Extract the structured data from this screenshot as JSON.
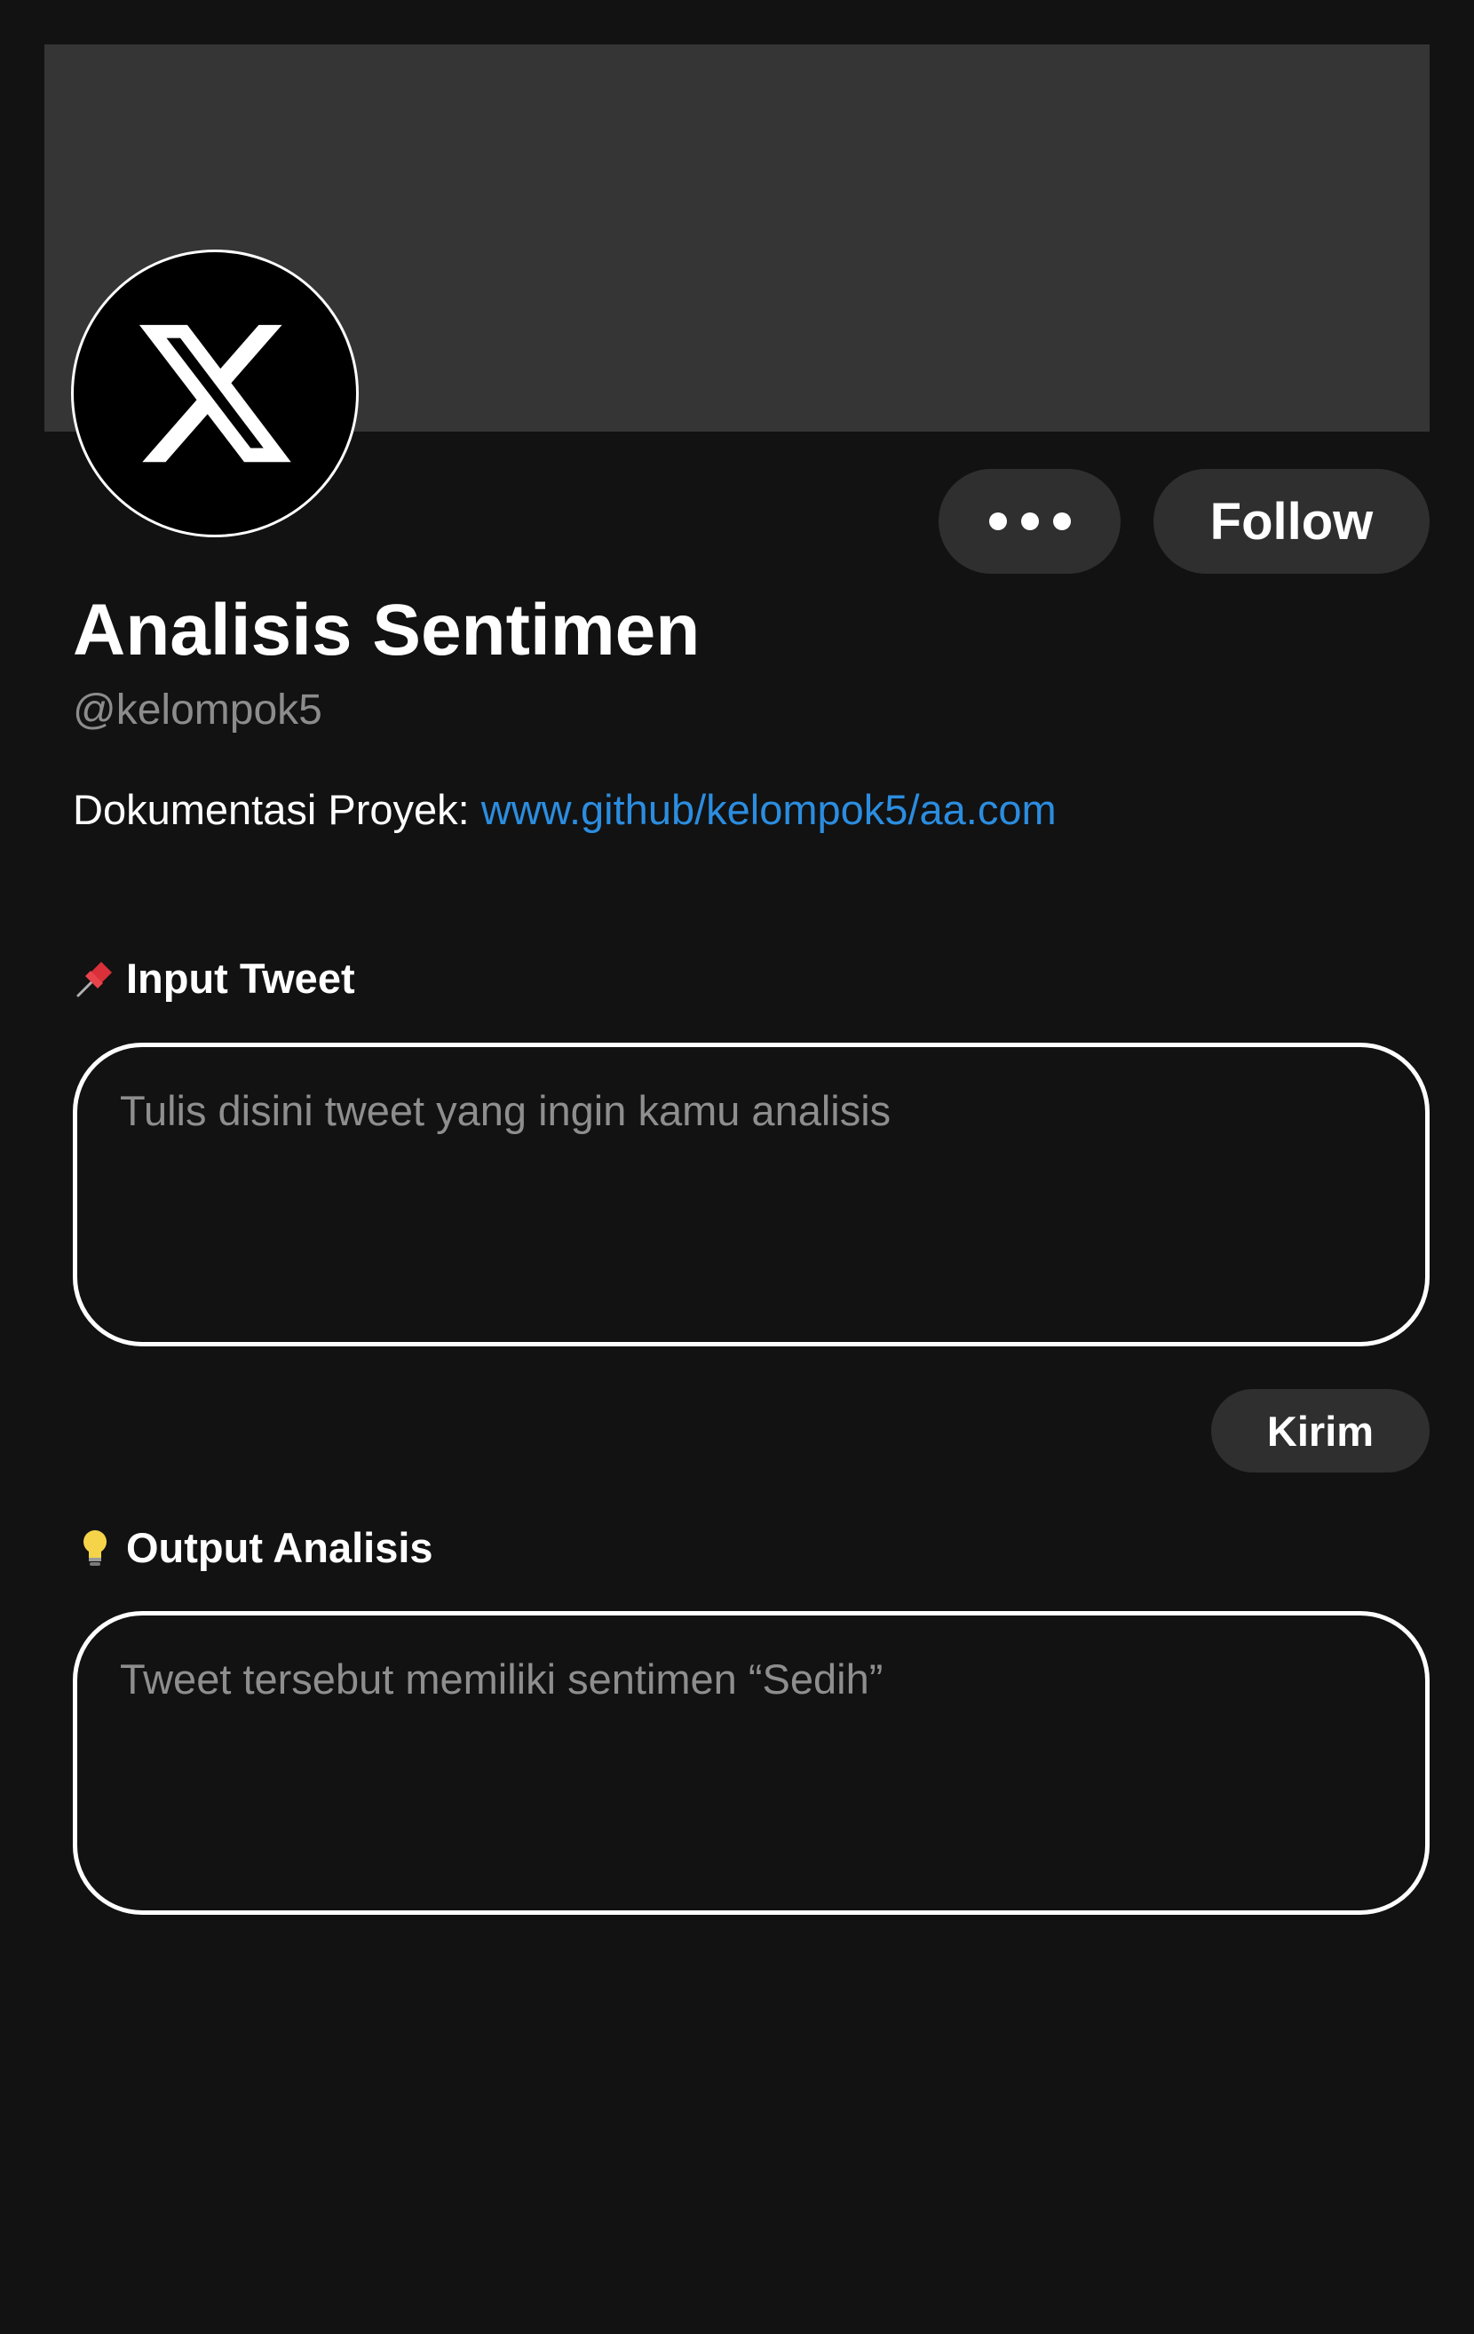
{
  "profile": {
    "name": "Analisis Sentimen",
    "handle": "@kelompok5",
    "bio_prefix": "Dokumentasi Proyek: ",
    "bio_link": "www.github/kelompok5/aa.com",
    "avatar_icon": "x-logo-icon"
  },
  "actions": {
    "more_icon": "more-horizontal-icon",
    "follow_label": "Follow"
  },
  "input_section": {
    "icon": "pushpin-icon",
    "label": "Input Tweet",
    "placeholder": "Tulis disini tweet yang ingin kamu analisis",
    "value": "",
    "submit_label": "Kirim"
  },
  "output_section": {
    "icon": "light-bulb-icon",
    "label": "Output Analisis",
    "result": "Tweet tersebut memiliki sentimen “Sedih”"
  },
  "colors": {
    "background": "#121212",
    "banner": "#353535",
    "button": "#2f2f2f",
    "link": "#2b8de0",
    "muted_text": "#8c8c8c"
  }
}
